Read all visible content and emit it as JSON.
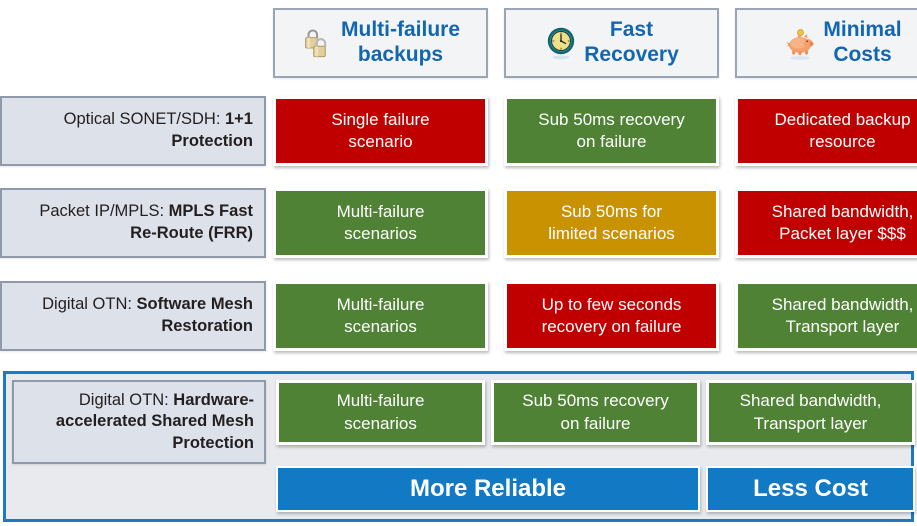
{
  "header": {
    "columns": [
      {
        "icon": "padlocks-icon",
        "label": "Multi-failure\nbackups"
      },
      {
        "icon": "clock-icon",
        "label": "Fast\nRecovery"
      },
      {
        "icon": "piggy-bank-icon",
        "label": "Minimal\nCosts"
      }
    ]
  },
  "rows": [
    {
      "label_prefix": "Optical SONET/SDH: ",
      "label_strong": "1+1 Protection",
      "cells": [
        {
          "text": "Single failure\nscenario",
          "status": "red"
        },
        {
          "text": "Sub 50ms recovery\non failure",
          "status": "green"
        },
        {
          "text": "Dedicated backup\nresource",
          "status": "red"
        }
      ]
    },
    {
      "label_prefix": "Packet IP/MPLS: ",
      "label_strong": "MPLS Fast Re-Route (FRR)",
      "cells": [
        {
          "text": "Multi-failure\nscenarios",
          "status": "green"
        },
        {
          "text": "Sub 50ms for\nlimited scenarios",
          "status": "gold"
        },
        {
          "text": "Shared bandwidth,\nPacket layer $$$",
          "status": "red"
        }
      ]
    },
    {
      "label_prefix": "Digital OTN: ",
      "label_strong": "Software Mesh Restoration",
      "cells": [
        {
          "text": "Multi-failure\nscenarios",
          "status": "green"
        },
        {
          "text": "Up to few seconds\nrecovery on failure",
          "status": "red"
        },
        {
          "text": "Shared bandwidth,\nTransport layer",
          "status": "green"
        }
      ]
    }
  ],
  "highlight_row": {
    "label_prefix": "Digital OTN: ",
    "label_strong": "Hardware-accelerated Shared Mesh Protection",
    "cells": [
      {
        "text": "Multi-failure\nscenarios",
        "status": "green"
      },
      {
        "text": "Sub 50ms recovery\non failure",
        "status": "green"
      },
      {
        "text": "Shared bandwidth,\nTransport layer",
        "status": "green"
      }
    ],
    "banners": [
      {
        "text": "More Reliable"
      },
      {
        "text": "Less Cost"
      }
    ]
  },
  "colors": {
    "red": "#c00000",
    "green": "#4f8234",
    "gold": "#c89200",
    "banner_blue": "#1279c4",
    "highlight_border": "#1b7ac2",
    "header_text_blue": "#1366b0",
    "label_fill": "#dde1e9",
    "label_border": "#8e99aa"
  }
}
